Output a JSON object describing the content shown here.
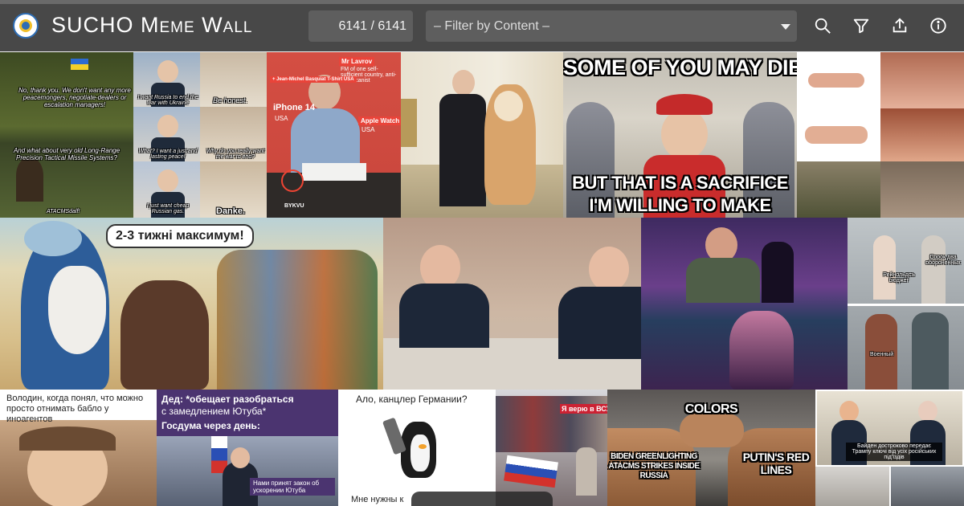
{
  "header": {
    "app_title": "SUCHO Meme Wall",
    "counter_text": "6141 / 6141",
    "filter_placeholder": "– Filter by Content –",
    "icons": [
      "search-icon",
      "filter-icon",
      "upload-icon",
      "info-icon"
    ],
    "bg_color": "#484848"
  },
  "memes": {
    "gandalf": {
      "top": "No, thank you. We don't want any more peacemongers, negotiate-dealers or escalation managers!",
      "mid": "And what about very old Long-Range Precision Tactical Missile Systems?",
      "bot": "ATACMSdalf!"
    },
    "scholz": {
      "a": "I want Russia to end the war with Ukraine",
      "b": "Be honest.",
      "c": "What? I want a just and lasting peace!",
      "d": "Why do you really want the war to end?",
      "e": "I just want cheap Russian gas.",
      "f": "Danke."
    },
    "lavrov": {
      "l1": "Mr Lavrov",
      "l2": "FM of one self-sufficient country, anti-Americanist",
      "l3": "+ Jean-Michel Basquiat T-Shirt USA",
      "l4": "iPhone 14",
      "l5": "USA",
      "l6": "Apple Watch",
      "l7": "USA",
      "l8": "BYKVU"
    },
    "sacrifice": {
      "top": "SOME OF YOU MAY DIE",
      "bot1": "BUT THAT IS A SACRIFICE",
      "bot2": "I'M WILLING TO MAKE"
    },
    "moses": {
      "bubble": "2-3 тижні максимум!"
    },
    "purple": {
      "a": "Рейнольдсъ бюджет",
      "b": "Сорок два обороненных",
      "c": "Военный"
    },
    "wideguy": {
      "text": "Володин, когда понял, что можно просто отнимать бабло у иноагентов"
    },
    "duma": {
      "line1": "Дед: *обещает разобраться",
      "line2": "с замедлением Ютуба*",
      "line3": "Госдума через день:",
      "caption": "Нами принят закон об ускорении Ютуба"
    },
    "penguin": {
      "top": "Ало, канцлер Германии?",
      "bottom": "Мне нужны к"
    },
    "crowd": {
      "note": "Я верю в ВСУ !"
    },
    "handshake": {
      "title": "COLORS",
      "left": "BIDEN GREENLIGHTING ATACMS STRIKES INSIDE RUSSIA",
      "right": "PUTIN'S RED LINES"
    },
    "trump": {
      "caption": "Байден достроково передає Трампу ключі від усіх російських під'їздів"
    }
  }
}
